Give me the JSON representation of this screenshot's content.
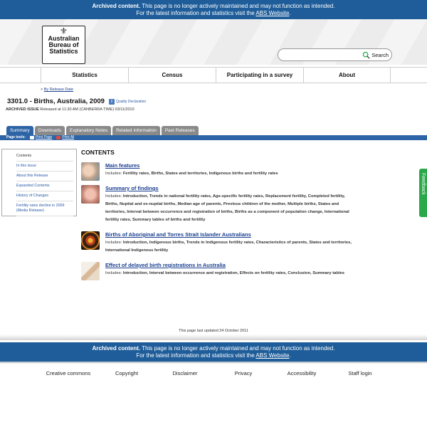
{
  "banner": {
    "archived": "Archived content.",
    "line1_rest": "This page is no longer actively maintained and may not function as intended.",
    "line2_prefix": "For the latest information and statistics visit the",
    "link": "ABS Website",
    "period": "."
  },
  "logo": {
    "line1": "Australian",
    "line2": "Bureau of",
    "line3": "Statistics"
  },
  "search": {
    "value": "",
    "placeholder": "",
    "button": "Search"
  },
  "nav": {
    "items": [
      "Statistics",
      "Census",
      "Participating in a survey",
      "About"
    ]
  },
  "breadcrumb": {
    "sep": ">",
    "link": "By Release Date"
  },
  "page": {
    "title": "3301.0 - Births, Australia, 2009",
    "quality": "Quality Declaration",
    "archived_label": "ARCHIVED ISSUE",
    "released": "Released at 11:30 AM (CANBERRA TIME) 03/11/2010"
  },
  "tabs": [
    "Summary",
    "Downloads",
    "Explanatory Notes",
    "Related Information",
    "Past Releases"
  ],
  "toolbar": {
    "label": "Page tools:",
    "print": "Print Page",
    "print_all": "Print All"
  },
  "sidebar": {
    "items": [
      "Contents",
      "In this issue",
      "About this Release",
      "Expanded Contents",
      "History of Changes",
      "Fertility rates decline in 2009 (Media Release)"
    ]
  },
  "main": {
    "heading": "CONTENTS",
    "includes_label": "Includes:",
    "entries": [
      {
        "title": "Main features",
        "includes": "Fertility rates, Births, States and territories, Indigenous births and fertility rates"
      },
      {
        "title": "Summary of findings",
        "includes": "Introduction, Trends in national fertility rates, Age-specific fertility rates, Replacement fertility, Completed fertility, Births, Nuptial and ex-nuptial births, Median age of parents, Previous children of the mother, Multiple births, States and territories, Interval between occurrence and registration of births, Births as a component of population change, International fertility rates, Summary tables of births and fertility"
      },
      {
        "title": "Births of Aboriginal and Torres Strait Islander Australians",
        "includes": "Introduction, Indigenous births, Trends in Indigenous fertility rates, Characteristics of parents, States and territories, International Indigenous fertility"
      },
      {
        "title": "Effect of delayed birth registrations in Australia",
        "includes": "Introduction, Interval between occurrence and registration, Effects on fertility rates, Conclusion, Summary tables"
      }
    ]
  },
  "feedback": "Feedback",
  "updated": "This page last updated 24 October 2011",
  "footer": [
    "Creative commons",
    "Copyright",
    "Disclaimer",
    "Privacy",
    "Accessibility",
    "Staff login"
  ],
  "colors": {
    "banner": "#1f5d9a",
    "tab_active": "#2d64a6",
    "tab_inactive": "#8a8a8a",
    "feedback": "#2aa84a",
    "link": "#1a3f8f"
  }
}
